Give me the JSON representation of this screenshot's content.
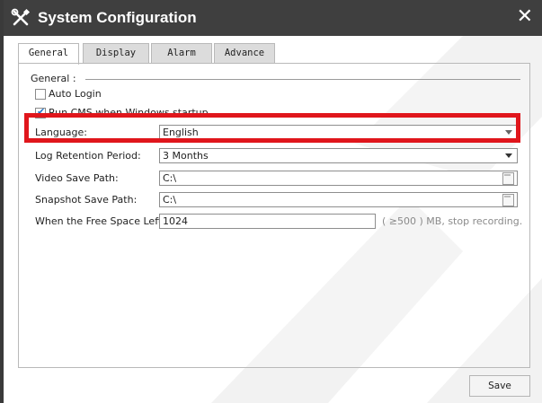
{
  "window": {
    "title": "System Configuration",
    "close_glyph": "✕",
    "icon": "tools-icon"
  },
  "tabs": [
    {
      "label": "General",
      "active": true
    },
    {
      "label": "Display",
      "active": false
    },
    {
      "label": "Alarm",
      "active": false
    },
    {
      "label": "Advance",
      "active": false
    }
  ],
  "general": {
    "group_label": "General :",
    "auto_login": {
      "label": "Auto Login",
      "checked": false
    },
    "run_on_startup": {
      "label": "Run CMS when Windows startup",
      "checked": true
    },
    "language": {
      "label": "Language:",
      "value": "English"
    },
    "log_retention": {
      "label": "Log Retention Period:",
      "value": "3 Months"
    },
    "video_path": {
      "label": "Video Save Path:",
      "value": "C:\\"
    },
    "snapshot_path": {
      "label": "Snapshot Save Path:",
      "value": "C:\\"
    },
    "free_space": {
      "label": "When the Free Space Left:",
      "value": "1024",
      "hint": "( ≥500 ) MB, stop recording."
    }
  },
  "footer": {
    "save_label": "Save"
  },
  "colors": {
    "titlebar": "#3f3f3f",
    "highlight": "#e0161c",
    "checkmark": "#1a73c8",
    "watermark": "#f0f0f0"
  }
}
